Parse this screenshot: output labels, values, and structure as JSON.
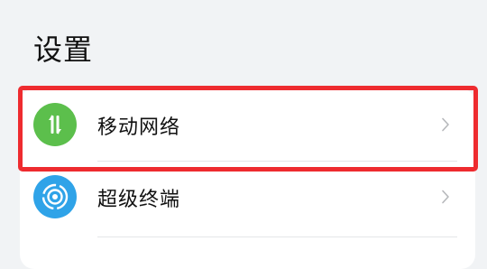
{
  "header": {
    "title": "设置"
  },
  "settings_list": {
    "items": [
      {
        "label": "移动网络",
        "icon": "mobile-data-icon",
        "icon_color": "#5cbf4c"
      },
      {
        "label": "超级终端",
        "icon": "super-device-icon",
        "icon_color": "#2fa3e8"
      }
    ]
  },
  "highlight": {
    "color": "#ee2b2f"
  }
}
